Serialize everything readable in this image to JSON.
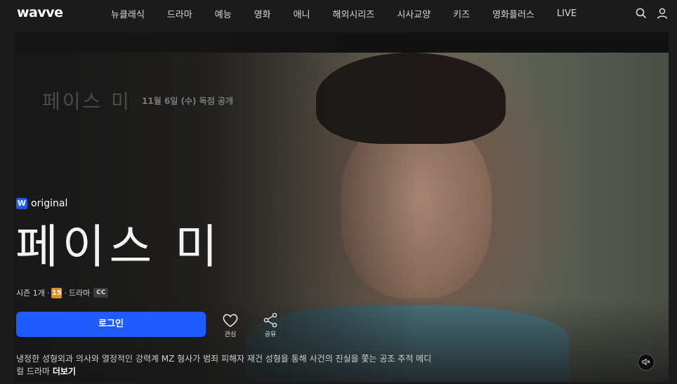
{
  "brand": {
    "logo": "wavve"
  },
  "nav": {
    "items": [
      "뉴클래식",
      "드라마",
      "예능",
      "영화",
      "애니",
      "해외시리즈",
      "시사교양",
      "키즈",
      "영화플러스",
      "LIVE"
    ]
  },
  "icons": {
    "search": "search-icon",
    "profile": "user-icon",
    "like": "heart-icon",
    "share": "share-icon",
    "mute": "speaker-mute-icon"
  },
  "colors": {
    "accent": "#1f5cff",
    "rating": "#e38a1f",
    "background": "#1b1b1b"
  },
  "hero": {
    "poster_title": "페이스 미",
    "release_text": "11월 6일 (수) 독점 공개",
    "badge_letter": "W",
    "badge_label": "original",
    "title": "페이스 미",
    "meta": {
      "season": "시즌 1개",
      "rating": "15",
      "genre": "드라마",
      "cc": "CC"
    },
    "login_button": "로그인",
    "like_label": "관심",
    "share_label": "공유",
    "description": "냉정한 성형외과 의사와 열정적인 강력계 MZ 형사가 범죄 피해자 재건 성형을 통해 사건의 진실을 쫓는 공조 추적 메디컬 드라마",
    "more_label": "더보기"
  }
}
